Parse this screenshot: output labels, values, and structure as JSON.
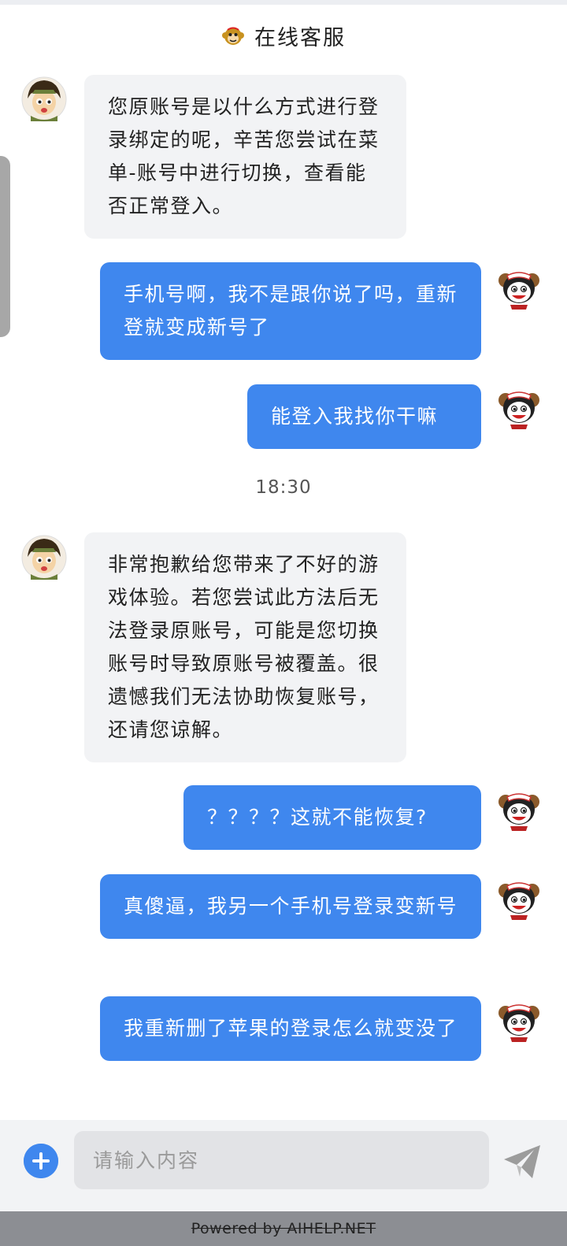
{
  "header": {
    "title": "在线客服",
    "logo_icon": "monkey-logo-icon"
  },
  "messages": [
    {
      "role": "agent",
      "text": "您原账号是以什么方式进行登录绑定的呢，辛苦您尝试在菜单-账号中进行切换，查看能否正常登入。",
      "avatar": "agent-avatar"
    },
    {
      "role": "user",
      "text": "手机号啊，我不是跟你说了吗，重新登就变成新号了",
      "avatar": "user-avatar"
    },
    {
      "role": "user",
      "text": "能登入我找你干嘛",
      "avatar": "user-avatar"
    },
    {
      "role": "agent",
      "text": "非常抱歉给您带来了不好的游戏体验。若您尝试此方法后无法登录原账号，可能是您切换账号时导致原账号被覆盖。很遗憾我们无法协助恢复账号，还请您谅解。",
      "avatar": "agent-avatar"
    },
    {
      "role": "user",
      "text": "？？？？这就不能恢复?",
      "avatar": "user-avatar"
    },
    {
      "role": "user",
      "text": "真傻逼，我另一个手机号登录变新号",
      "avatar": "user-avatar"
    },
    {
      "role": "user",
      "text": "我重新删了苹果的登录怎么就变没了",
      "avatar": "user-avatar"
    }
  ],
  "timestamp": "18:30",
  "input": {
    "placeholder": "请输入内容",
    "value": ""
  },
  "footer": {
    "powered_by": "Powered by AIHELP.NET"
  },
  "colors": {
    "user_bubble": "#3f87ee",
    "agent_bubble": "#f2f3f5",
    "accent": "#3f87ee"
  }
}
